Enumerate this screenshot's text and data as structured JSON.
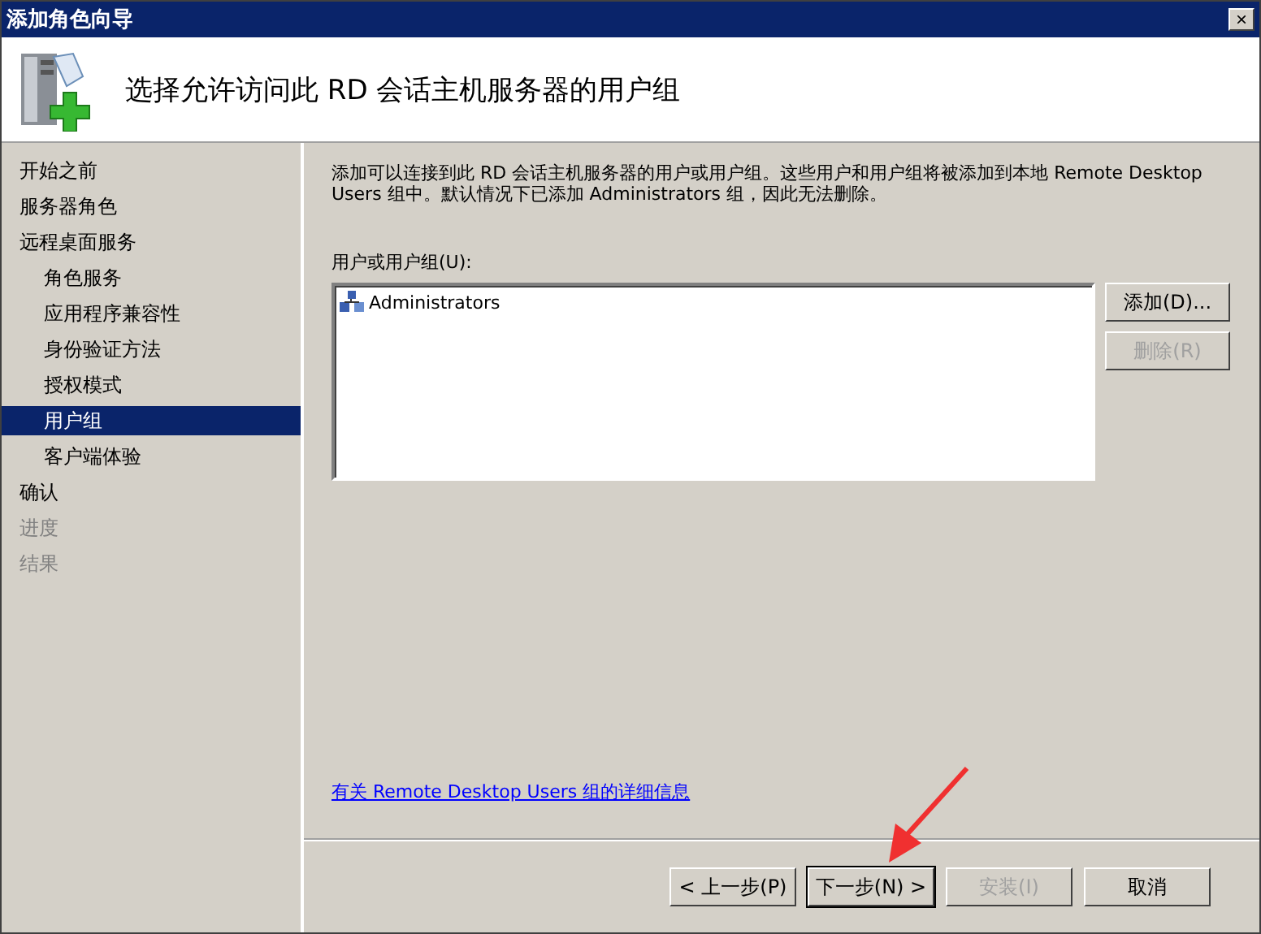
{
  "window": {
    "title": "添加角色向导",
    "close": "×"
  },
  "header": {
    "title": "选择允许访问此 RD 会话主机服务器的用户组"
  },
  "sidebar": {
    "items": [
      {
        "label": "开始之前",
        "selected": false,
        "disabled": false
      },
      {
        "label": "服务器角色",
        "selected": false,
        "disabled": false
      },
      {
        "label": "远程桌面服务",
        "selected": false,
        "disabled": false,
        "children": [
          {
            "label": "角色服务",
            "selected": false,
            "disabled": false
          },
          {
            "label": "应用程序兼容性",
            "selected": false,
            "disabled": false
          },
          {
            "label": "身份验证方法",
            "selected": false,
            "disabled": false
          },
          {
            "label": "授权模式",
            "selected": false,
            "disabled": false
          },
          {
            "label": "用户组",
            "selected": true,
            "disabled": false
          },
          {
            "label": "客户端体验",
            "selected": false,
            "disabled": false
          }
        ]
      },
      {
        "label": "确认",
        "selected": false,
        "disabled": false
      },
      {
        "label": "进度",
        "selected": false,
        "disabled": true
      },
      {
        "label": "结果",
        "selected": false,
        "disabled": true
      }
    ]
  },
  "content": {
    "description": "添加可以连接到此 RD 会话主机服务器的用户或用户组。这些用户和用户组将被添加到本地 Remote Desktop Users 组中。默认情况下已添加 Administrators 组，因此无法删除。",
    "list_label": "用户或用户组(U):",
    "list_items": [
      {
        "label": "Administrators"
      }
    ],
    "list_buttons": [
      {
        "label": "添加(D)...",
        "disabled": false
      },
      {
        "label": "删除(R)",
        "disabled": true
      }
    ],
    "link": "有关 Remote Desktop Users 组的详细信息"
  },
  "footer_buttons": [
    {
      "label": "< 上一步(P)",
      "disabled": false,
      "default": false
    },
    {
      "label": "下一步(N) >",
      "disabled": false,
      "default": true
    },
    {
      "label": "安装(I)",
      "disabled": true,
      "default": false
    },
    {
      "label": "取消",
      "disabled": false,
      "default": false
    }
  ]
}
